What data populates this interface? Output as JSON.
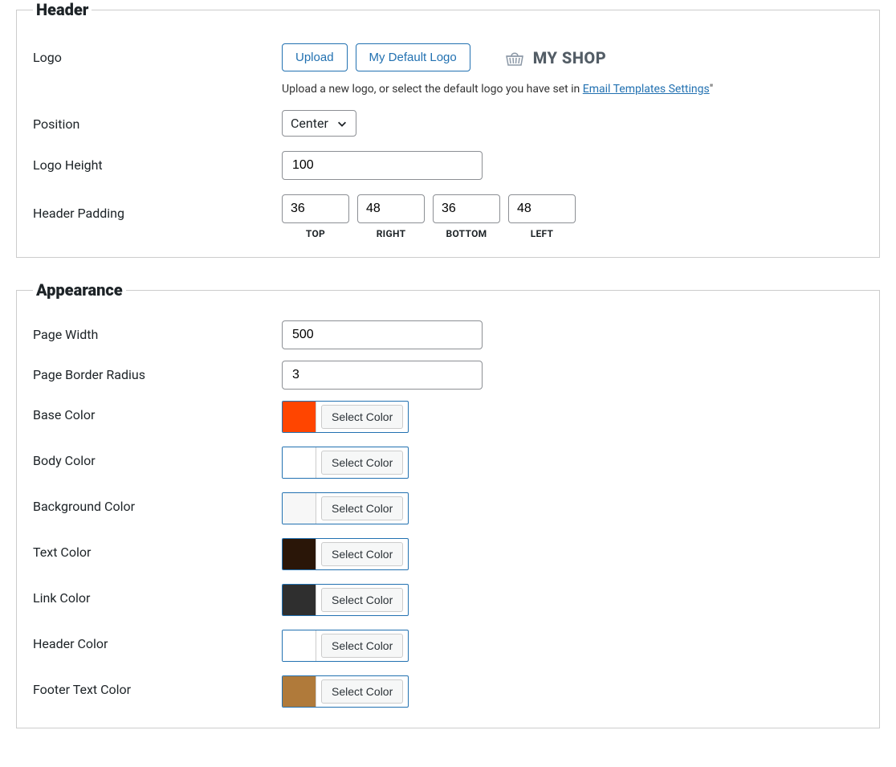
{
  "header_section": {
    "legend": "Header",
    "logo": {
      "label": "Logo",
      "upload_btn": "Upload",
      "default_btn": "My Default Logo",
      "preview_text": "MY SHOP",
      "help_prefix": "Upload a new logo, or select the default logo you have set in ",
      "help_link": "Email Templates Settings",
      "help_suffix": "\""
    },
    "position": {
      "label": "Position",
      "value": "Center"
    },
    "logo_height": {
      "label": "Logo Height",
      "value": "100"
    },
    "padding": {
      "label": "Header Padding",
      "items": [
        {
          "value": "36",
          "label": "TOP"
        },
        {
          "value": "48",
          "label": "RIGHT"
        },
        {
          "value": "36",
          "label": "BOTTOM"
        },
        {
          "value": "48",
          "label": "LEFT"
        }
      ]
    }
  },
  "appearance_section": {
    "legend": "Appearance",
    "page_width": {
      "label": "Page Width",
      "value": "500"
    },
    "page_border_radius": {
      "label": "Page Border Radius",
      "value": "3"
    },
    "select_color_label": "Select Color",
    "colors": [
      {
        "key": "base",
        "label": "Base Color",
        "hex": "#ff4500"
      },
      {
        "key": "body",
        "label": "Body Color",
        "hex": "#ffffff"
      },
      {
        "key": "background",
        "label": "Background Color",
        "hex": "#f7f7f7"
      },
      {
        "key": "text",
        "label": "Text Color",
        "hex": "#2a1608"
      },
      {
        "key": "link",
        "label": "Link Color",
        "hex": "#2f2f2f"
      },
      {
        "key": "header",
        "label": "Header Color",
        "hex": "#ffffff"
      },
      {
        "key": "footer_text",
        "label": "Footer Text Color",
        "hex": "#b07a3a"
      }
    ]
  }
}
